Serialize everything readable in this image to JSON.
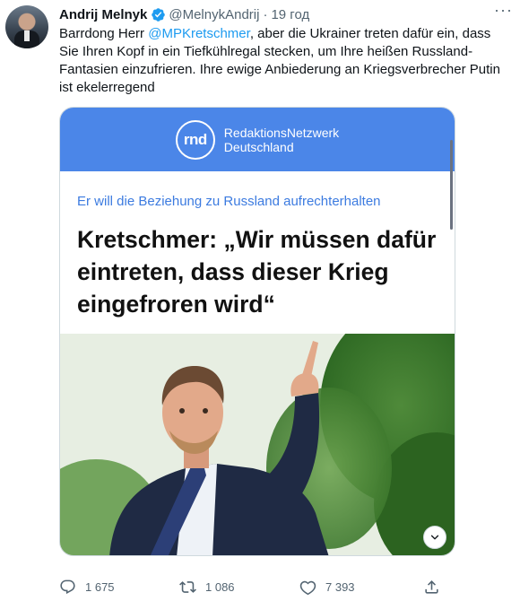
{
  "tweet": {
    "author_name": "Andrij Melnyk",
    "handle": "@MelnykAndrij",
    "separator": "·",
    "time": "19 год",
    "more_label": "···",
    "text_before": "Barrdong Herr ",
    "mention": "@MPKretschmer",
    "text_after": ", aber die Ukrainer treten dafür ein, dass Sie Ihren Kopf in ein Tiefkühlregal stecken, um Ihre heißen Russland-Fantasien einzufrieren. Ihre ewige Anbiederung an Kriegsverbrecher Putin ist ekelerregend"
  },
  "card": {
    "logo_text": "rnd",
    "brand_line1": "RedaktionsNetzwerk",
    "brand_line2": "Deutschland",
    "kicker": "Er will die Beziehung zu Russland aufrechterhalten",
    "headline": "Kretschmer: „Wir müssen dafür eintreten, dass dieser Krieg eingefroren wird“",
    "banner_color": "#4b86e8",
    "kicker_color": "#3c7be0"
  },
  "actions": {
    "replies": "1 675",
    "retweets": "1 086",
    "likes": "7 393"
  },
  "icons": {
    "verified": "verified-badge-icon",
    "reply": "reply-icon",
    "retweet": "retweet-icon",
    "like": "heart-icon",
    "share": "share-icon",
    "expand": "chevron-down-icon"
  },
  "colors": {
    "accent": "#1d9bf0",
    "secondary_text": "#536471"
  }
}
